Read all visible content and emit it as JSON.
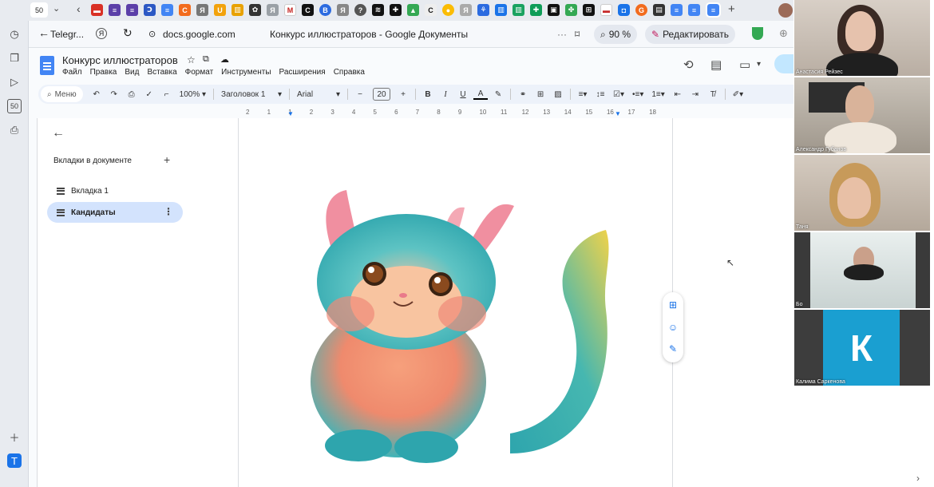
{
  "browser": {
    "tab_count": "50",
    "back_label": "Telegr...",
    "yandex_icon": "Я",
    "url": "docs.google.com",
    "page_title": "Конкурс иллюстраторов - Google Документы",
    "zoom_label": "90 %",
    "edit_label": "Редактировать",
    "rail_badge": "50"
  },
  "doc": {
    "title": "Конкурс иллюстраторов",
    "menu": [
      "Файл",
      "Правка",
      "Вид",
      "Вставка",
      "Формат",
      "Инструменты",
      "Расширения",
      "Справка"
    ]
  },
  "toolbar": {
    "search_label": "Меню",
    "zoom": "100%",
    "style": "Заголовок 1",
    "font": "Arial",
    "font_size": "20",
    "bold": "B",
    "italic": "I",
    "underline": "U",
    "text_color": "A"
  },
  "ruler": {
    "ticks": [
      "2",
      "1",
      "1",
      "2",
      "3",
      "4",
      "5",
      "6",
      "7",
      "8",
      "9",
      "10",
      "11",
      "12",
      "13",
      "14",
      "15",
      "16",
      "17",
      "18"
    ]
  },
  "sidebar": {
    "heading": "Вкладки в документе",
    "tabs": [
      {
        "label": "Вкладка 1",
        "active": false
      },
      {
        "label": "Кандидаты",
        "active": true
      }
    ]
  },
  "participants": [
    {
      "name": "Анастасия Рейзес"
    },
    {
      "name": "Александр Губанов"
    },
    {
      "name": "Таня"
    },
    {
      "name": "Бо"
    },
    {
      "name": "Калима Саркенова",
      "initial": "К"
    }
  ],
  "colors": {
    "accent": "#1a73e8",
    "docs_blue": "#4285f4",
    "active_tab": "#d3e3fd",
    "avatar_tile": "#1a9fd1"
  }
}
